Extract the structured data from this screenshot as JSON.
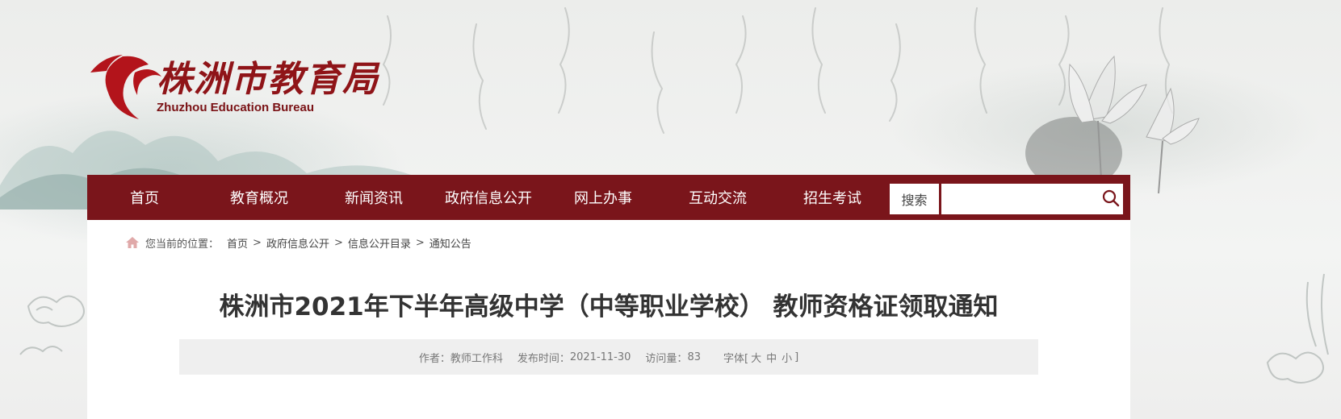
{
  "header": {
    "logo_cn": "株洲市教育局",
    "logo_en": "Zhuzhou Education Bureau"
  },
  "nav": {
    "items": [
      {
        "label": "首页"
      },
      {
        "label": "教育概况"
      },
      {
        "label": "新闻资讯"
      },
      {
        "label": "政府信息公开"
      },
      {
        "label": "网上办事"
      },
      {
        "label": "互动交流"
      },
      {
        "label": "招生考试"
      }
    ],
    "search_label": "搜索",
    "search_value": ""
  },
  "breadcrumb": {
    "prefix": "您当前的位置：",
    "items": [
      "首页",
      "政府信息公开",
      "信息公开目录",
      "通知公告"
    ],
    "separator": ">"
  },
  "article": {
    "title": "株洲市2021年下半年高级中学（中等职业学校） 教师资格证领取通知",
    "author_label": "作者：",
    "author": "教师工作科",
    "date_label": "发布时间：",
    "date": "2021-11-30",
    "views_label": "访问量：",
    "views": "83",
    "font_label": "字体[",
    "font_large": "大",
    "font_medium": "中",
    "font_small": "小",
    "font_close": "]"
  },
  "colors": {
    "brand": "#7a151b",
    "logo": "#8f1418"
  },
  "icons": {
    "home": "home-icon",
    "search": "search-icon"
  }
}
